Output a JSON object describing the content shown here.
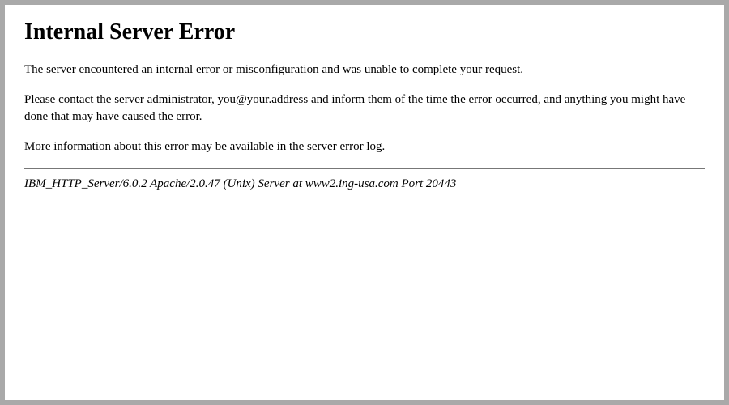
{
  "error": {
    "title": "Internal Server Error",
    "paragraph1": "The server encountered an internal error or misconfiguration and was unable to complete your request.",
    "paragraph2": "Please contact the server administrator, you@your.address and inform them of the time the error occurred, and anything you might have done that may have caused the error.",
    "paragraph3": "More information about this error may be available in the server error log.",
    "footer": "IBM_HTTP_Server/6.0.2 Apache/2.0.47 (Unix) Server at www2.ing-usa.com Port 20443"
  }
}
